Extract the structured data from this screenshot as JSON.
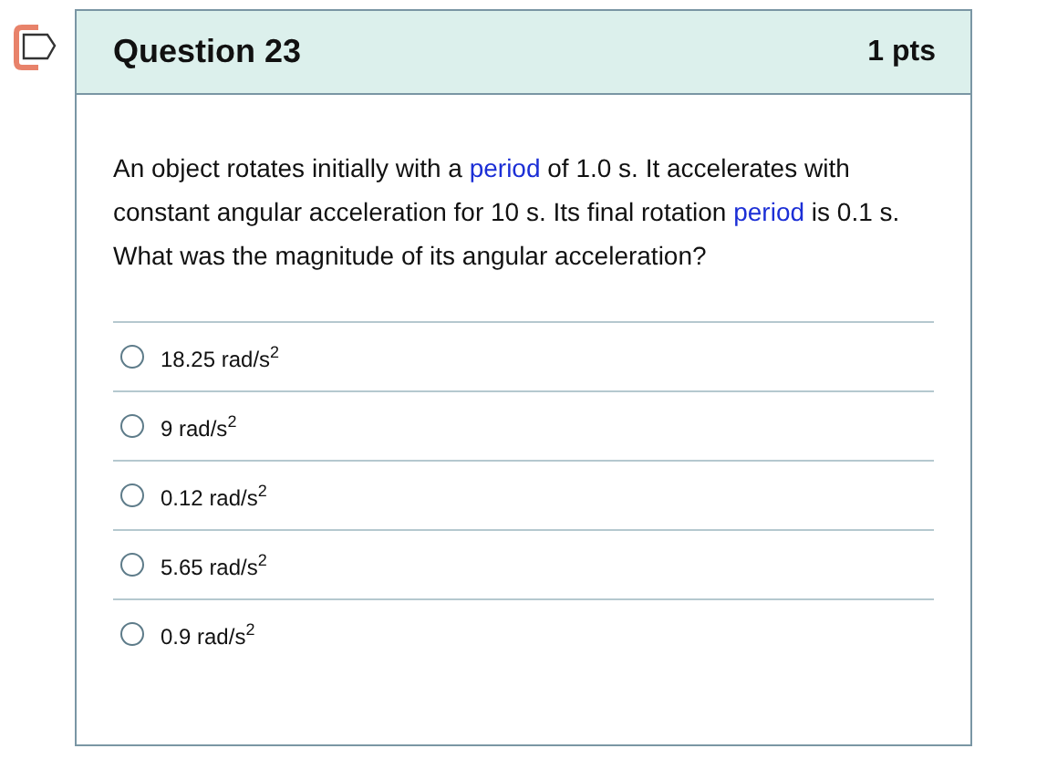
{
  "question": {
    "title": "Question 23",
    "points": "1 pts"
  },
  "paragraphs": [
    {
      "segments": [
        {
          "kind": "text",
          "text": "An object rotates initially with a "
        },
        {
          "kind": "link",
          "text": "period"
        },
        {
          "kind": "text",
          "text": " of 1.0 s.  It accelerates with constant angular acceleration for 10 s.  Its final rotation "
        },
        {
          "kind": "link",
          "text": "period"
        },
        {
          "kind": "text",
          "text": " is 0.1 s."
        }
      ]
    },
    {
      "segments": [
        {
          "kind": "text",
          "text": "What was the magnitude of its angular acceleration?"
        }
      ]
    }
  ],
  "answers": [
    {
      "label": "18.25 rad/s$^{2}$",
      "selected": false
    },
    {
      "label": "9 rad/s$^{2}$",
      "selected": false
    },
    {
      "label": "0.12 rad/s$^{2}$",
      "selected": false
    },
    {
      "label": "5.65 rad/s$^{2}$",
      "selected": false
    },
    {
      "label": "0.9 rad/s$^{2}$",
      "selected": false
    }
  ]
}
